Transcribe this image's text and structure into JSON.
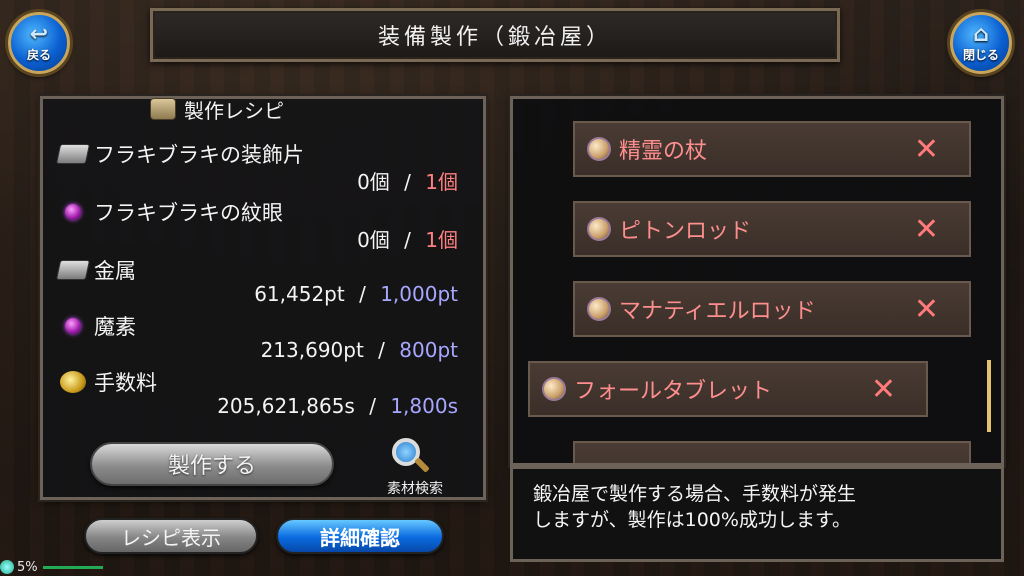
{
  "header": {
    "title": "装備製作（鍛冶屋）"
  },
  "nav": {
    "back_label": "戻る",
    "close_label": "閉じる"
  },
  "recipe": {
    "heading": "製作レシピ",
    "materials": [
      {
        "name": "フラキブラキの装飾片",
        "owned": "0個",
        "separator": "/",
        "required": "1個",
        "icon": "ingot-icon",
        "req_color": "red"
      },
      {
        "name": "フラキブラキの紋眼",
        "owned": "0個",
        "separator": "/",
        "required": "1個",
        "icon": "orb-icon",
        "req_color": "red"
      },
      {
        "name": "金属",
        "owned": "61,452pt",
        "separator": "/",
        "required": "1,000pt",
        "icon": "ingot-icon",
        "req_color": "blue"
      },
      {
        "name": "魔素",
        "owned": "213,690pt",
        "separator": "/",
        "required": "800pt",
        "icon": "orb-icon",
        "req_color": "blue"
      },
      {
        "name": "手数料",
        "owned": "205,621,865s",
        "separator": "/",
        "required": "1,800s",
        "icon": "coins-icon",
        "req_color": "blue"
      }
    ],
    "craft_label": "製作する",
    "search_label": "素材検索"
  },
  "buttons": {
    "recipe_view": "レシピ表示",
    "detail_confirm": "詳細確認"
  },
  "list": {
    "items": [
      {
        "name": "精霊の杖",
        "mark": "✕"
      },
      {
        "name": "ピトンロッド",
        "mark": "✕"
      },
      {
        "name": "マナティエルロッド",
        "mark": "✕"
      },
      {
        "name": "フォールタブレット",
        "mark": "✕"
      }
    ]
  },
  "message": {
    "line1": "鍛冶屋で製作する場合、手数料が発生",
    "line2": "しますが、製作は100%成功します。"
  },
  "status": {
    "percent": "5%"
  },
  "colors": {
    "required_red": "#ff8080",
    "required_blue": "#a7a7ff",
    "item_text": "#ff8e8e",
    "accent_blue": "#0a6ae0"
  }
}
